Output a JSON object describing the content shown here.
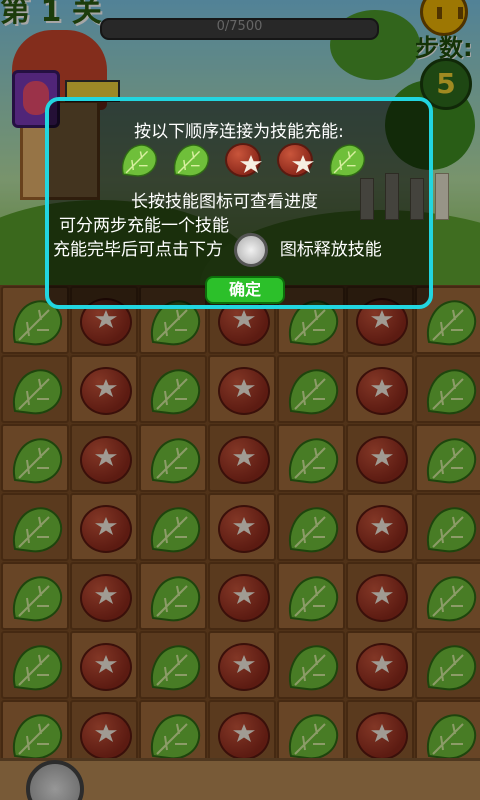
{
  "hud": {
    "level_label": "第 1 关",
    "score_text": "0/7500",
    "steps_label": "步数:",
    "steps_value": "5",
    "pause_icon": "pause-icon"
  },
  "dialog": {
    "title": "按以下顺序连接为技能充能:",
    "sequence": [
      "cabbage",
      "cabbage",
      "mushroom",
      "mushroom",
      "cabbage"
    ],
    "line1": "长按技能图标可查看进度",
    "line2": "可分两步充能一个技能",
    "line3_before": "充能完毕后可点击下方",
    "line3_after": "图标释放技能",
    "confirm_label": "确定",
    "border_color": "#22d6e0"
  },
  "board": {
    "rows": [
      [
        "cabbage",
        "mushroom",
        "cabbage",
        "mushroom",
        "cabbage",
        "mushroom",
        "cabbage"
      ],
      [
        "cabbage",
        "mushroom",
        "cabbage",
        "mushroom",
        "cabbage",
        "mushroom",
        "cabbage"
      ],
      [
        "cabbage",
        "mushroom",
        "cabbage",
        "mushroom",
        "cabbage",
        "mushroom",
        "cabbage"
      ],
      [
        "cabbage",
        "mushroom",
        "cabbage",
        "mushroom",
        "cabbage",
        "mushroom",
        "cabbage"
      ],
      [
        "cabbage",
        "mushroom",
        "cabbage",
        "mushroom",
        "cabbage",
        "mushroom",
        "cabbage"
      ],
      [
        "cabbage",
        "mushroom",
        "cabbage",
        "mushroom",
        "cabbage",
        "mushroom",
        "cabbage"
      ],
      [
        "cabbage",
        "mushroom",
        "cabbage",
        "mushroom",
        "cabbage",
        "mushroom",
        "cabbage"
      ]
    ]
  },
  "colors": {
    "cabbage": "#6fbf3a",
    "mushroom": "#a33a25",
    "accent": "#22d6e0",
    "button": "#2cc02a"
  }
}
